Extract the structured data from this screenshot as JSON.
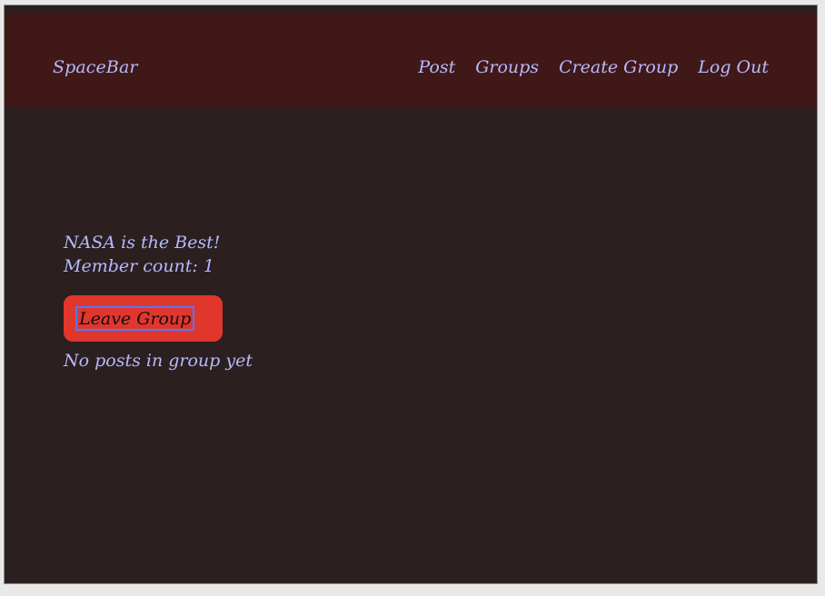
{
  "header": {
    "brand": "SpaceBar",
    "nav": [
      {
        "label": "Post"
      },
      {
        "label": "Groups"
      },
      {
        "label": "Create Group"
      },
      {
        "label": "Log Out"
      }
    ]
  },
  "group": {
    "name": "NASA is the Best!",
    "member_count_text": "Member count: 1",
    "leave_button_label": "Leave Group",
    "empty_posts_text": "No posts in group yet"
  },
  "colors": {
    "page_background": "#2c1f1f",
    "navbar_background": "#411818",
    "text": "#b5baff",
    "button_background": "#e1362c",
    "focus_outline": "#4f79ff"
  }
}
